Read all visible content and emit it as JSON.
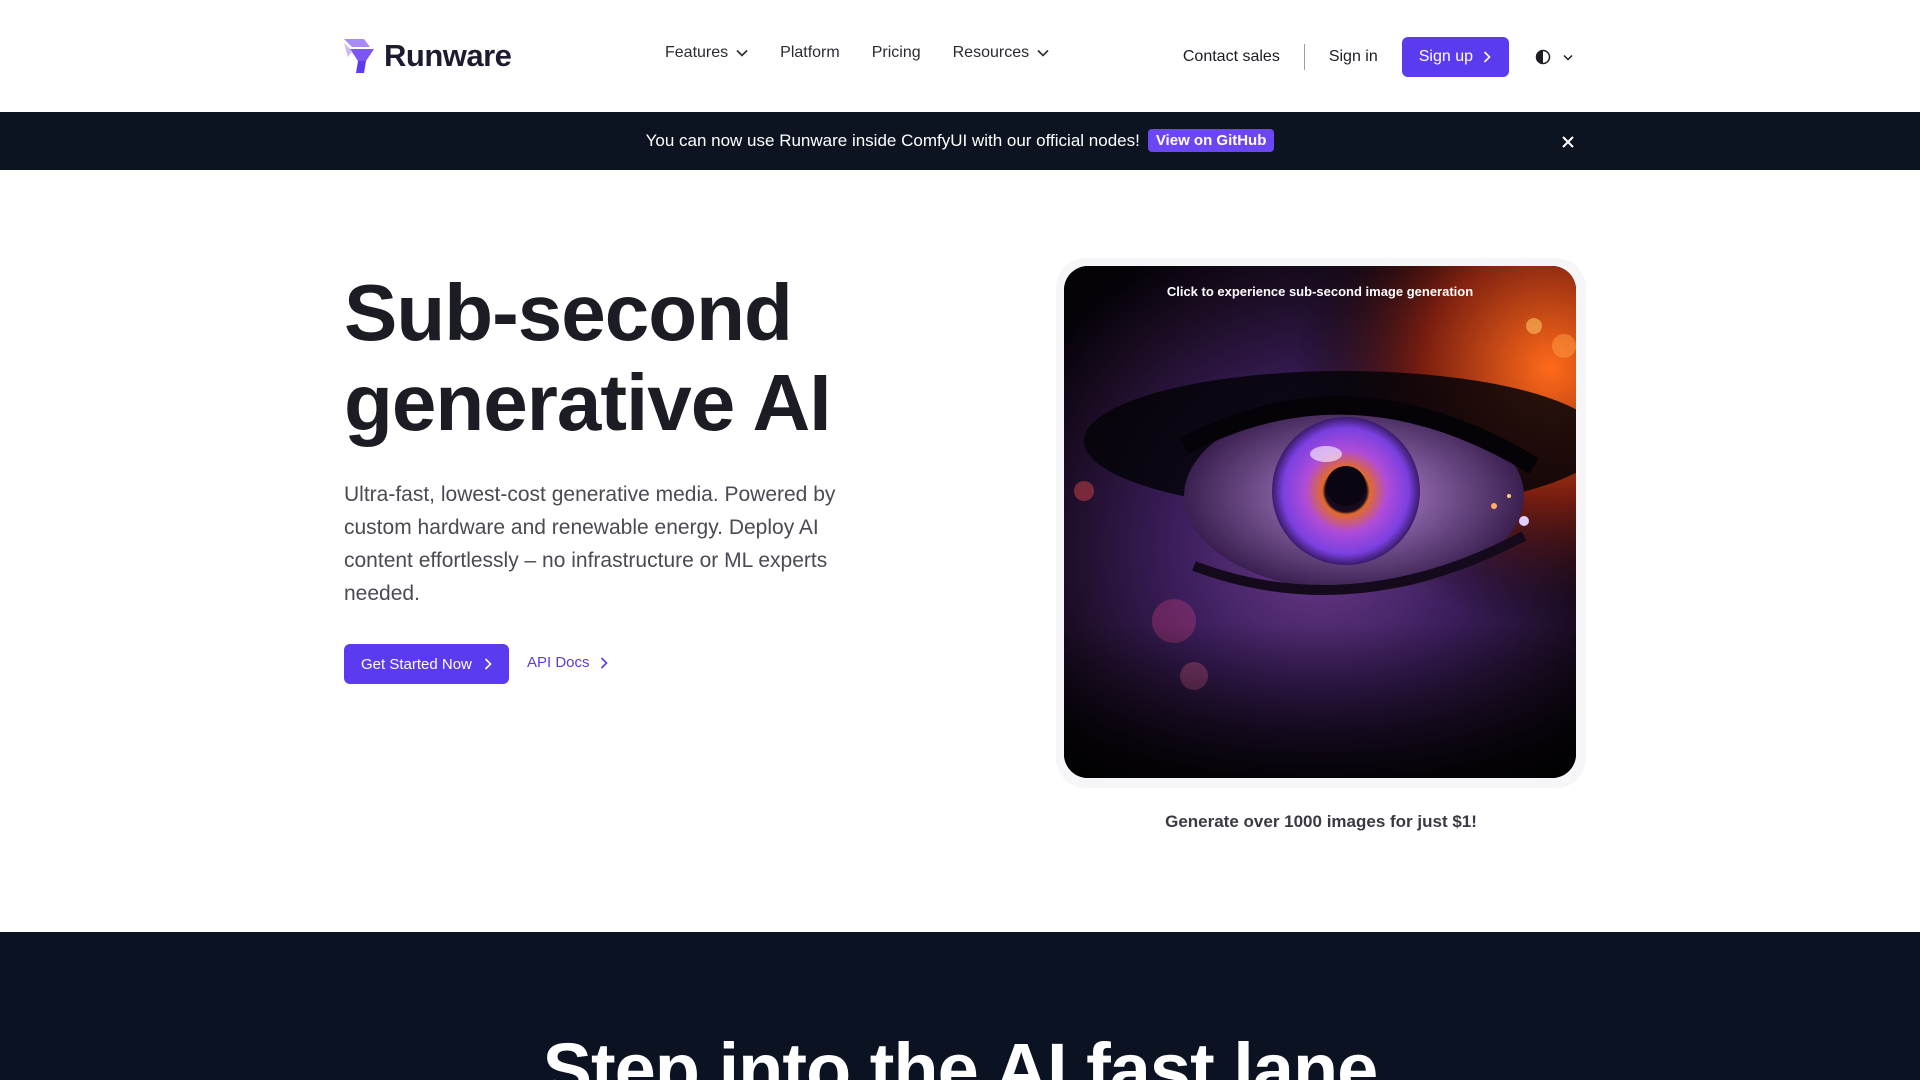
{
  "header": {
    "brand": "Runware",
    "nav": [
      {
        "label": "Features",
        "has_dropdown": true
      },
      {
        "label": "Platform",
        "has_dropdown": false
      },
      {
        "label": "Pricing",
        "has_dropdown": false
      },
      {
        "label": "Resources",
        "has_dropdown": true
      }
    ],
    "contact_label": "Contact sales",
    "signin_label": "Sign in",
    "signup_label": "Sign up",
    "theme_icon": "half-circle-icon"
  },
  "banner": {
    "text": "You can now use Runware inside ComfyUI with our official nodes!",
    "button_label": "View on GitHub"
  },
  "hero": {
    "title_line1": "Sub-second",
    "title_line2": "generative AI",
    "subtitle": "Ultra-fast, lowest-cost generative media. Powered by custom hardware and renewable energy. Deploy AI content effortlessly – no infrastructure or ML experts needed.",
    "cta_label": "Get Started Now",
    "api_label": "API Docs",
    "demo_caption": "Click to experience sub-second image generation",
    "note": "Generate over 1000 images for just $1!"
  },
  "section2": {
    "title": "Step into the AI fast lane"
  },
  "colors": {
    "accent": "#5b3af0",
    "banner_bg": "#0c1422",
    "dark_section_bg": "#0b1322"
  }
}
